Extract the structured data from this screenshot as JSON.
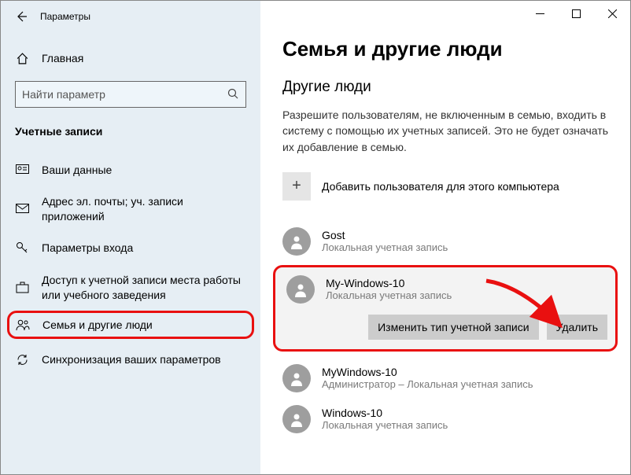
{
  "window": {
    "title": "Параметры"
  },
  "home": {
    "label": "Главная"
  },
  "search": {
    "placeholder": "Найти параметр"
  },
  "section": {
    "header": "Учетные записи"
  },
  "nav": {
    "your_info": "Ваши данные",
    "email": "Адрес эл. почты; уч. записи приложений",
    "signin": "Параметры входа",
    "work": "Доступ к учетной записи места работы или учебного заведения",
    "family": "Семья и другие люди",
    "sync": "Синхронизация ваших параметров"
  },
  "page": {
    "title": "Семья и другие люди",
    "subtitle": "Другие люди",
    "description": "Разрешите пользователям, не включенным в семью, входить в систему с помощью их учетных записей. Это не будет означать их добавление в семью.",
    "add_user": "Добавить пользователя для этого компьютера"
  },
  "users": [
    {
      "name": "Gost",
      "role": "Локальная учетная запись"
    },
    {
      "name": "My-Windows-10",
      "role": "Локальная учетная запись"
    },
    {
      "name": "MyWindows-10",
      "role": "Администратор – Локальная учетная запись"
    },
    {
      "name": "Windows-10",
      "role": "Локальная учетная запись"
    }
  ],
  "actions": {
    "change_type": "Изменить тип учетной записи",
    "remove": "Удалить"
  }
}
